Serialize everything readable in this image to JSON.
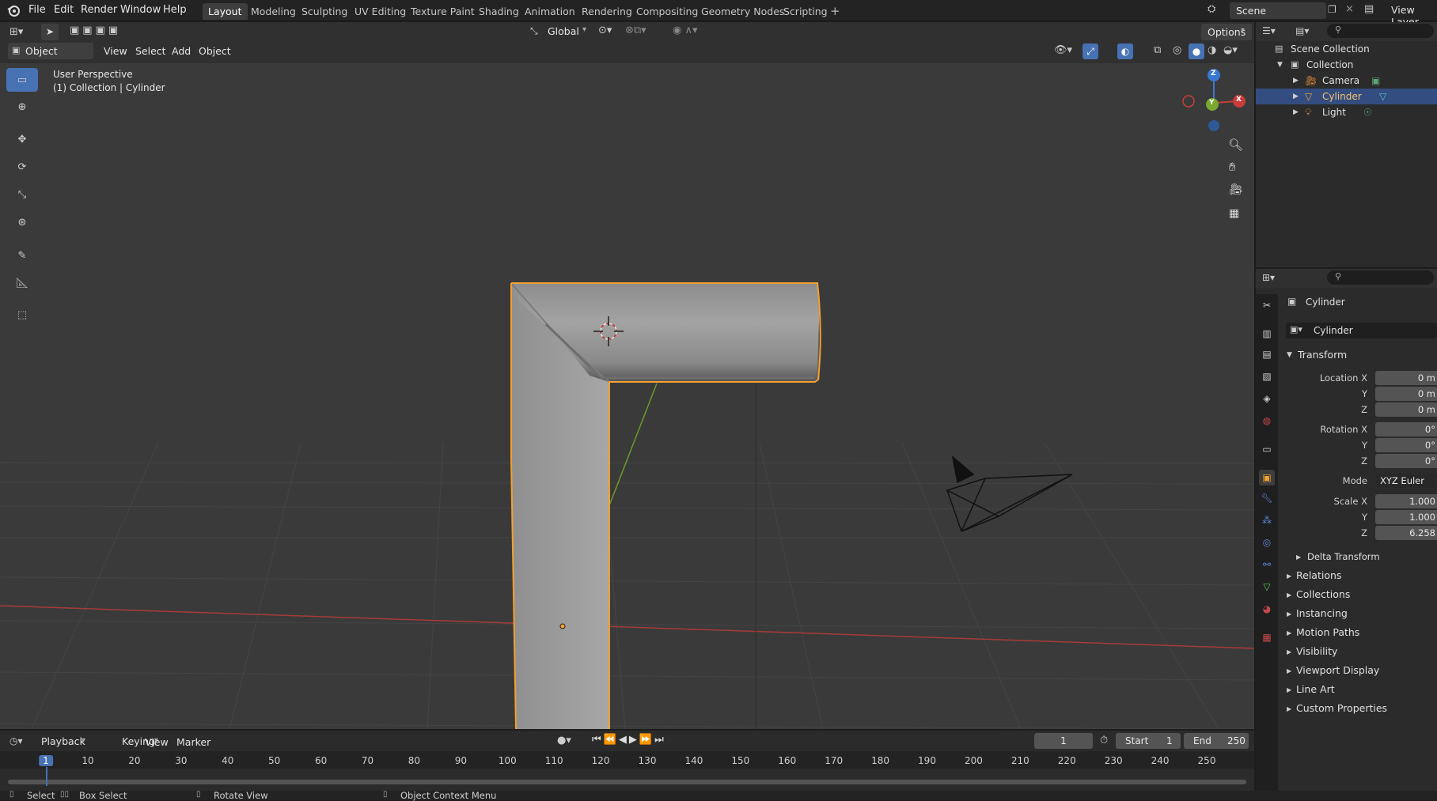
{
  "topbar": {
    "menus": [
      "File",
      "Edit",
      "Render",
      "Window",
      "Help"
    ],
    "workspaces": [
      "Layout",
      "Modeling",
      "Sculpting",
      "UV Editing",
      "Texture Paint",
      "Shading",
      "Animation",
      "Rendering",
      "Compositing",
      "Geometry Nodes",
      "Scripting"
    ],
    "active_workspace": "Layout",
    "scene_name": "Scene",
    "view_layer": "View Layer"
  },
  "viewport_header": {
    "mode": "Object Mode",
    "menus": [
      "View",
      "Select",
      "Add",
      "Object"
    ],
    "orientation": "Global",
    "options_label": "Options"
  },
  "viewport": {
    "perspective_label": "User Perspective",
    "context_label": "(1) Collection | Cylinder",
    "gizmo_axes": {
      "z": "Z",
      "y": "Y",
      "x": "X"
    }
  },
  "outliner": {
    "scene_collection": "Scene Collection",
    "collection": "Collection",
    "items": [
      {
        "name": "Camera"
      },
      {
        "name": "Cylinder"
      },
      {
        "name": "Light"
      }
    ]
  },
  "properties": {
    "object_name": "Cylinder",
    "data_name": "Cylinder",
    "transform_label": "Transform",
    "location_label": "Location X",
    "location": [
      "0 m",
      "0 m",
      "0 m"
    ],
    "rotation_label": "Rotation X",
    "rotation": [
      "0°",
      "0°",
      "0°"
    ],
    "mode_label": "Mode",
    "mode_value": "XYZ Euler",
    "scale_label": "Scale X",
    "scale": [
      "1.000",
      "1.000",
      "6.258"
    ],
    "y_label": "Y",
    "z_label": "Z",
    "delta_transform": "Delta Transform",
    "panels": [
      "Relations",
      "Collections",
      "Instancing",
      "Motion Paths",
      "Visibility",
      "Viewport Display",
      "Line Art",
      "Custom Properties"
    ]
  },
  "timeline": {
    "menus": [
      "Playback",
      "Keying",
      "View",
      "Marker"
    ],
    "current_frame": "1",
    "start_label": "Start",
    "start_value": "1",
    "end_label": "End",
    "end_value": "250",
    "ticks": [
      "1",
      "10",
      "20",
      "30",
      "40",
      "50",
      "60",
      "70",
      "80",
      "90",
      "100",
      "110",
      "120",
      "130",
      "140",
      "150",
      "160",
      "170",
      "180",
      "190",
      "200",
      "210",
      "220",
      "230",
      "240",
      "250"
    ]
  },
  "statusbar": {
    "select": "Select",
    "box_select": "Box Select",
    "rotate_view": "Rotate View",
    "context_menu": "Object Context Menu"
  },
  "colors": {
    "accent": "#4772b3",
    "selection_outline": "#f5a030",
    "x_axis": "#c83c3c",
    "y_axis": "#78a830",
    "z_axis": "#3a78d0"
  }
}
